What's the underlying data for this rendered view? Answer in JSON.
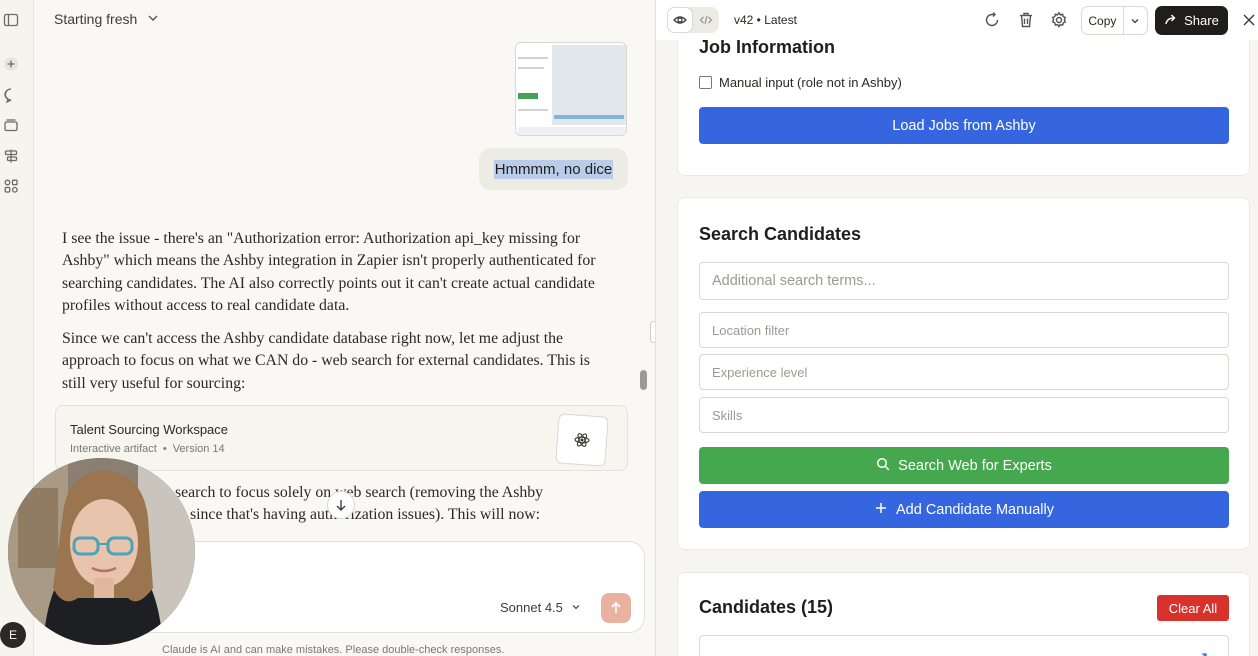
{
  "rail": {
    "icons": [
      "sidebar-toggle-icon",
      "plus-icon",
      "chat-icon",
      "projects-icon",
      "artifacts-icon",
      "code-icon"
    ]
  },
  "chat": {
    "title": "Starting fresh",
    "user_message": "Hmmmm, no dice",
    "paragraphs": [
      "I see the issue - there's an \"Authorization error: Authorization api_key missing for Ashby\" which means the Ashby integration in Zapier isn't properly authenticated for searching candidates. The AI also correctly points out it can't create actual candidate profiles without access to real candidate data.",
      "Since we can't access the Ashby candidate database right now, let me adjust the approach to focus on what we CAN do - web search for external candidates. This is still very useful for sourcing:"
    ],
    "artifact": {
      "title": "Talent Sourcing Workspace",
      "type": "Interactive artifact",
      "version": "Version 14"
    },
    "continued_lines": [
      "search to focus solely on web search (removing the Ashby",
      "since that's having authorization issues). This will now:"
    ],
    "model": "Sonnet 4.5",
    "disclaimer": "Claude is AI and can make mistakes. Please double-check responses.",
    "user_initial": "E"
  },
  "panel": {
    "version_label": "v42 • Latest",
    "copy_label": "Copy",
    "share_label": "Share",
    "job_section": {
      "title": "Job Information",
      "manual_checkbox_label": "Manual input (role not in Ashby)",
      "manual_checked": false,
      "load_button": "Load Jobs from Ashby"
    },
    "search_section": {
      "title": "Search Candidates",
      "search_placeholder": "Additional search terms...",
      "location_placeholder": "Location filter",
      "experience_placeholder": "Experience level",
      "skills_placeholder": "Skills",
      "search_button": "Search Web for Experts",
      "add_button": "Add Candidate Manually"
    },
    "candidates_section": {
      "title": "Candidates (15)",
      "clear_button": "Clear All"
    }
  },
  "colors": {
    "primary_blue": "#3566df",
    "success_green": "#45a84f",
    "danger_red": "#d8322d",
    "send_orange": "#e8b29f",
    "selection_highlight": "#b9cde8"
  }
}
